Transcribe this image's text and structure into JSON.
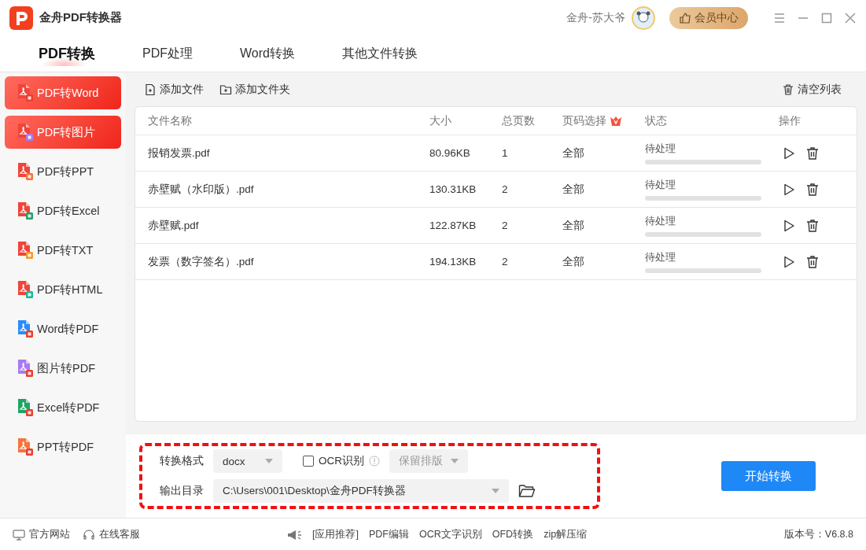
{
  "app": {
    "title": "金舟PDF转换器",
    "user": "金舟-苏大爷",
    "vip_button": "会员中心"
  },
  "tabs": [
    {
      "label": "PDF转换",
      "selected": true
    },
    {
      "label": "PDF处理",
      "selected": false
    },
    {
      "label": "Word转换",
      "selected": false
    },
    {
      "label": "其他文件转换",
      "selected": false
    }
  ],
  "sidebar": {
    "items": [
      {
        "label": "PDF转Word",
        "kind": "word",
        "selected": true
      },
      {
        "label": "PDF转图片",
        "kind": "image",
        "selected": true
      },
      {
        "label": "PDF转PPT",
        "kind": "ppt",
        "selected": false
      },
      {
        "label": "PDF转Excel",
        "kind": "excel",
        "selected": false
      },
      {
        "label": "PDF转TXT",
        "kind": "txt",
        "selected": false
      },
      {
        "label": "PDF转HTML",
        "kind": "html",
        "selected": false
      },
      {
        "label": "Word转PDF",
        "kind": "from-word",
        "selected": false
      },
      {
        "label": "图片转PDF",
        "kind": "from-image",
        "selected": false
      },
      {
        "label": "Excel转PDF",
        "kind": "from-excel",
        "selected": false
      },
      {
        "label": "PPT转PDF",
        "kind": "from-ppt",
        "selected": false
      }
    ]
  },
  "toolbar": {
    "add_file": "添加文件",
    "add_folder": "添加文件夹",
    "clear": "清空列表"
  },
  "table": {
    "columns": [
      "文件名称",
      "大小",
      "总页数",
      "页码选择",
      "状态",
      "操作"
    ],
    "rows": [
      {
        "name": "报销发票.pdf",
        "size": "80.96KB",
        "pages": "1",
        "range": "全部",
        "status": "待处理",
        "level": 0
      },
      {
        "name": "赤壁赋（水印版）.pdf",
        "size": "130.31KB",
        "pages": "2",
        "range": "全部",
        "status": "待处理",
        "level": 0
      },
      {
        "name": "赤壁赋.pdf",
        "size": "122.87KB",
        "pages": "2",
        "range": "全部",
        "status": "待处理",
        "level": 0
      },
      {
        "name": "发票（数字签名）.pdf",
        "size": "194.13KB",
        "pages": "2",
        "range": "全部",
        "status": "待处理",
        "level": 0
      }
    ]
  },
  "options": {
    "format_label": "转换格式",
    "format": "docx",
    "ocr": {
      "label": "OCR识别",
      "checked": false
    },
    "layout": {
      "value": "保留排版",
      "disabled": true
    },
    "output_label": "输出目录",
    "output_path": "C:\\Users\\001\\Desktop\\金舟PDF转换器",
    "start_button": "开始转换"
  },
  "footer": {
    "links": [
      "官方网站",
      "在线客服"
    ],
    "recommend": [
      "[应用推荐]",
      "PDF编辑",
      "OCR文字识别",
      "OFD转换",
      "zip解压缩"
    ],
    "version": "版本号：V6.8.8"
  }
}
